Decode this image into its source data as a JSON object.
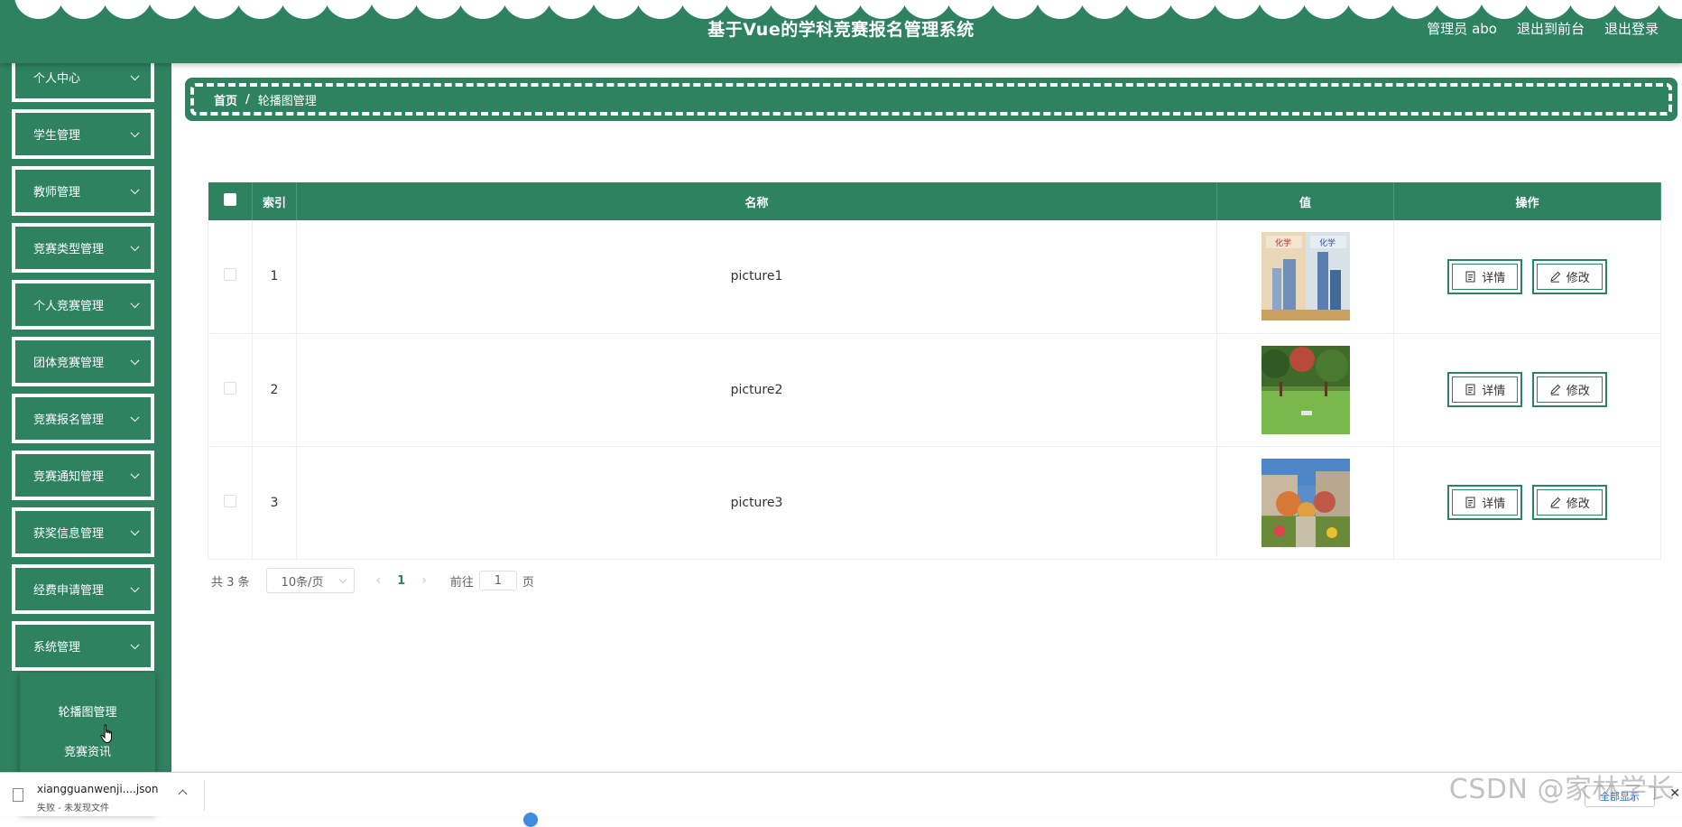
{
  "header": {
    "title": "基于Vue的学科竞赛报名管理系统",
    "user_label": "管理员 abo",
    "front_link": "退出到前台",
    "logout_link": "退出登录"
  },
  "sidebar": {
    "items": [
      {
        "label": "个人中心"
      },
      {
        "label": "学生管理"
      },
      {
        "label": "教师管理"
      },
      {
        "label": "竞赛类型管理"
      },
      {
        "label": "个人竞赛管理"
      },
      {
        "label": "团体竞赛管理"
      },
      {
        "label": "竞赛报名管理"
      },
      {
        "label": "竞赛通知管理"
      },
      {
        "label": "获奖信息管理"
      },
      {
        "label": "经费申请管理"
      },
      {
        "label": "系统管理"
      }
    ],
    "submenu": [
      {
        "label": "轮播图管理"
      },
      {
        "label": "竞赛资讯"
      }
    ]
  },
  "breadcrumb": {
    "home": "首页",
    "separator": "/",
    "current": "轮播图管理"
  },
  "table": {
    "headers": {
      "index": "索引",
      "name": "名称",
      "value": "值",
      "actions": "操作"
    },
    "rows": [
      {
        "index": "1",
        "name": "picture1",
        "image": "book-cover-picture"
      },
      {
        "index": "2",
        "name": "picture2",
        "image": "campus-lawn-picture"
      },
      {
        "index": "3",
        "name": "picture3",
        "image": "campus-garden-picture"
      }
    ],
    "detail_label": "详情",
    "edit_label": "修改"
  },
  "pagination": {
    "total_text": "共 3 条",
    "page_size": "10条/页",
    "current_page": "1",
    "goto_prefix": "前往",
    "goto_value": "1",
    "goto_suffix": "页"
  },
  "download_bar": {
    "file_name": "xiangguanwenji....json",
    "status": "失败 - 未发现文件",
    "show_all": "全部显示"
  },
  "watermark": "CSDN @家林学长",
  "colors": {
    "primary": "#2e8260",
    "white": "#ffffff"
  }
}
